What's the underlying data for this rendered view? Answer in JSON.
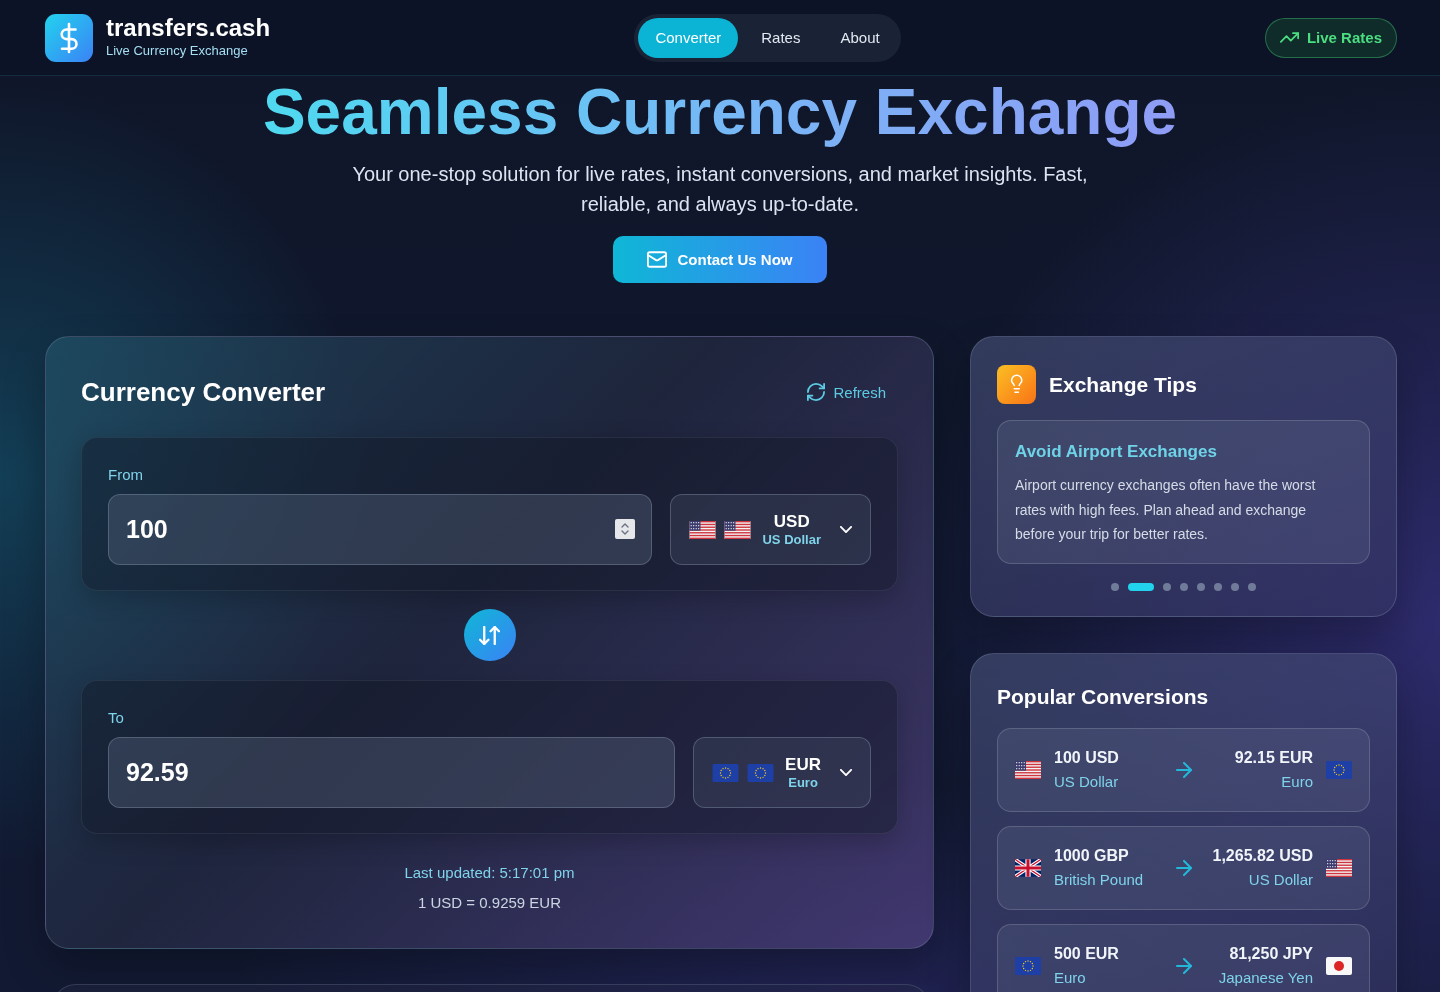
{
  "header": {
    "brand": {
      "name": "transfers.cash",
      "tagline": "Live Currency Exchange"
    },
    "nav": [
      {
        "label": "Converter",
        "selected": true
      },
      {
        "label": "Rates",
        "selected": false
      },
      {
        "label": "About",
        "selected": false
      }
    ],
    "live_button": "Live Rates"
  },
  "hero": {
    "title": "Seamless Currency Exchange",
    "subtitle": "Your one-stop solution for live rates, instant conversions, and market insights. Fast, reliable, and always up-to-date.",
    "button": "Contact Us Now"
  },
  "converter": {
    "title": "Currency Converter",
    "refresh": "Refresh",
    "from": {
      "label": "From",
      "value": "100",
      "stepper": true,
      "currency": {
        "code": "USD",
        "name": "US Dollar",
        "kind": "us"
      }
    },
    "to": {
      "label": "To",
      "value": "92.59",
      "stepper": false,
      "currency": {
        "code": "EUR",
        "name": "Euro",
        "kind": "eu"
      }
    },
    "last_updated": "Last updated: 5:17:01 pm",
    "rate": "1 USD = 0.9259 EUR"
  },
  "tips": {
    "title": "Exchange Tips",
    "tip": {
      "title": "Avoid Airport Exchanges",
      "text": "Airport currency exchanges often have the worst rates with high fees. Plan ahead and exchange before your trip for better rates."
    },
    "pages": [
      {
        "selected": false
      },
      {
        "selected": true
      },
      {
        "selected": false
      },
      {
        "selected": false
      },
      {
        "selected": false
      },
      {
        "selected": false
      },
      {
        "selected": false
      },
      {
        "selected": false
      }
    ]
  },
  "popular": {
    "title": "Popular Conversions",
    "rows": [
      {
        "from": {
          "amount": "100 USD",
          "name": "US Dollar",
          "kind": "us"
        },
        "to": {
          "amount": "92.15 EUR",
          "name": "Euro",
          "kind": "eu"
        }
      },
      {
        "from": {
          "amount": "1000 GBP",
          "name": "British Pound",
          "kind": "gb"
        },
        "to": {
          "amount": "1,265.82 USD",
          "name": "US Dollar",
          "kind": "us"
        }
      },
      {
        "from": {
          "amount": "500 EUR",
          "name": "Euro",
          "kind": "eu"
        },
        "to": {
          "amount": "81,250 JPY",
          "name": "Japanese Yen",
          "kind": "jp"
        }
      }
    ]
  }
}
